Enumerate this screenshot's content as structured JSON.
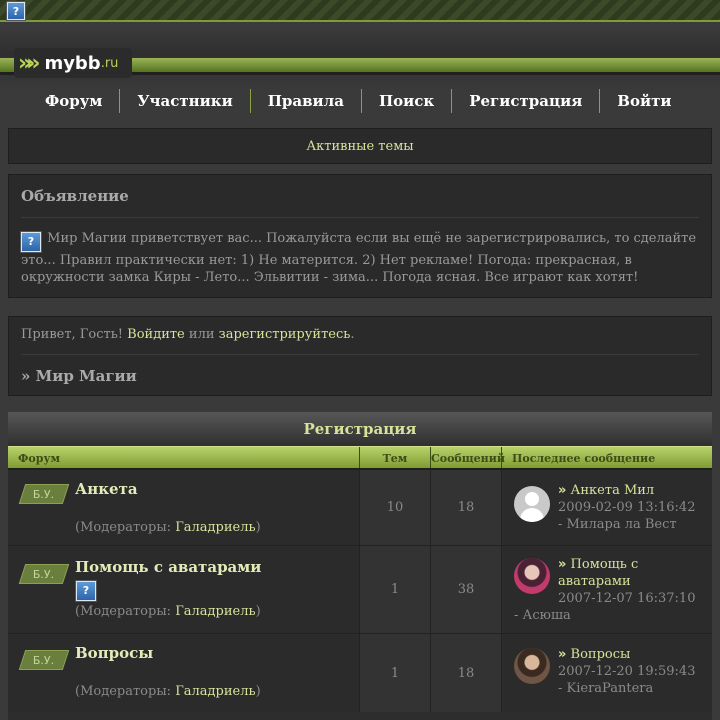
{
  "header": {
    "logo_brand": "mybb",
    "logo_tld": ".ru",
    "help_icon": "?"
  },
  "nav": {
    "items": [
      "Форум",
      "Участники",
      "Правила",
      "Поиск",
      "Регистрация",
      "Войти"
    ]
  },
  "active_topics": "Активные темы",
  "announcement": {
    "title": "Объявление",
    "text": "Мир Магии приветствует вас... Пожалуйста если вы ещё не зарегистрировались, то сделайте это... Правил практически нет: 1) Не матерится. 2) Нет рекламе! Погода: прекрасная, в окружности замка Киры - Лето... Эльвитии - зима... Погода ясная. Все играют как хотят!"
  },
  "welcome": {
    "greeting": "Привет, Гость!",
    "login_link": "Войдите",
    "or": "или",
    "register_link": "зарегистрируйтесь",
    "period": ".",
    "breadcrumb": "» Мир Магии"
  },
  "category": {
    "title": "Регистрация",
    "columns": {
      "forum": "Форум",
      "topics": "Тем",
      "posts": "Сообщений",
      "last_post": "Последнее сообщение"
    },
    "forums": [
      {
        "badge": "Б.У.",
        "title": "Анкета",
        "mods_prefix": "(Модераторы: ",
        "mod": "Галадриель",
        "mods_suffix": ")",
        "topics": "10",
        "posts": "18",
        "last_title": "Анкета Мил",
        "last_date": "2009-02-09 13:16:42",
        "last_author": "- Милара ла Вест"
      },
      {
        "badge": "Б.У.",
        "title": "Помощь с аватарами",
        "mods_prefix": "(Модераторы: ",
        "mod": "Галадриель",
        "mods_suffix": ")",
        "topics": "1",
        "posts": "38",
        "last_title": "Помощь с аватарами",
        "last_date": "2007-12-07 16:37:10",
        "last_author": "- Асюша"
      },
      {
        "badge": "Б.У.",
        "title": "Вопросы",
        "mods_prefix": "(Модераторы: ",
        "mod": "Галадриель",
        "mods_suffix": ")",
        "topics": "1",
        "posts": "18",
        "last_title": "Вопросы",
        "last_date": "2007-12-20 19:59:43",
        "last_author": "- KieraPantera"
      }
    ]
  },
  "icons": {
    "help": "question-mark-icon",
    "last_post_marker": "double-chevron-icon"
  },
  "colors": {
    "accent": "#b8d35a",
    "link": "#d5e49a",
    "background": "#3a3a3a"
  }
}
